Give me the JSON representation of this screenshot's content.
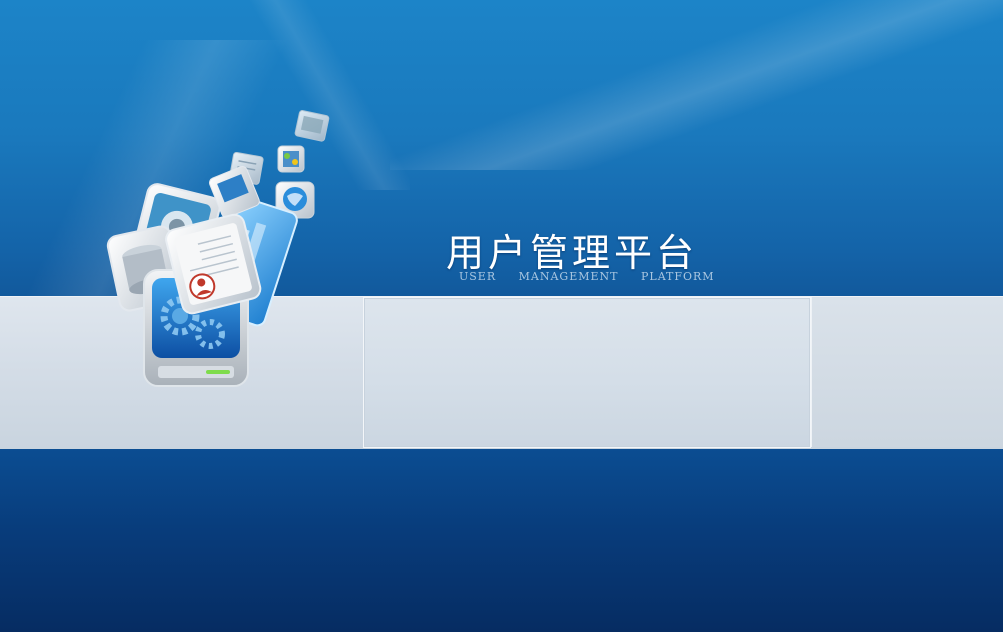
{
  "app": {
    "title": "用户管理平台",
    "subtitle_words": [
      "User",
      "management",
      "platform"
    ]
  },
  "colors": {
    "background_top": "#1a7ec4",
    "background_bottom": "#062c62",
    "strip": "#d4dde7",
    "title_text": "#ffffff",
    "subtitle_text": "#a9c6e0"
  },
  "illustration": {
    "icons": [
      "monitor-gear-icon",
      "user-document-icon",
      "database-icon",
      "globe-icon",
      "chart-icon",
      "picture-icon",
      "network-icon"
    ]
  }
}
